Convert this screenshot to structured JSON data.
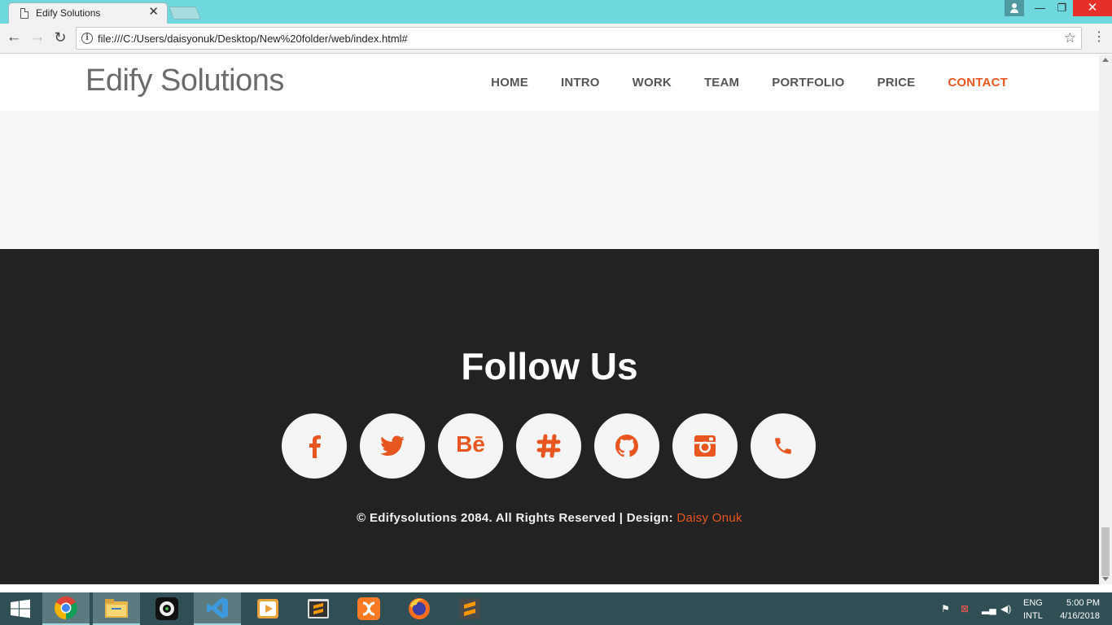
{
  "browser": {
    "tab_title": "Edify Solutions",
    "tab_close": "✕",
    "url": "file:///C:/Users/daisyonuk/Desktop/New%20folder/web/index.html#",
    "window_controls": {
      "minimize": "—",
      "maximize": "❐",
      "close": "✕"
    }
  },
  "site": {
    "brand": "Edify Solutions",
    "nav": [
      "HOME",
      "INTRO",
      "WORK",
      "TEAM",
      "PORTFOLIO",
      "PRICE",
      "CONTACT"
    ],
    "active_nav": "CONTACT",
    "accent_color": "#e8561f",
    "footer": {
      "title": "Follow Us",
      "socials": [
        "facebook-icon",
        "twitter-icon",
        "behance-icon",
        "slack-icon",
        "github-icon",
        "instagram-icon",
        "phone-icon"
      ],
      "behance_label": "Bē",
      "copyright": "© Edifysolutions 2084. All Rights Reserved | Design: ",
      "designer": "Daisy Onuk"
    }
  },
  "taskbar": {
    "apps": [
      "chrome-icon",
      "file-explorer-icon",
      "media-app-icon",
      "visual-studio-icon",
      "video-player-icon",
      "sublime-text-icon",
      "xampp-icon",
      "firefox-icon",
      "sublime-text-alt-icon"
    ],
    "language": "ENG",
    "layout": "INTL",
    "time": "5:00 PM",
    "date": "4/16/2018"
  }
}
